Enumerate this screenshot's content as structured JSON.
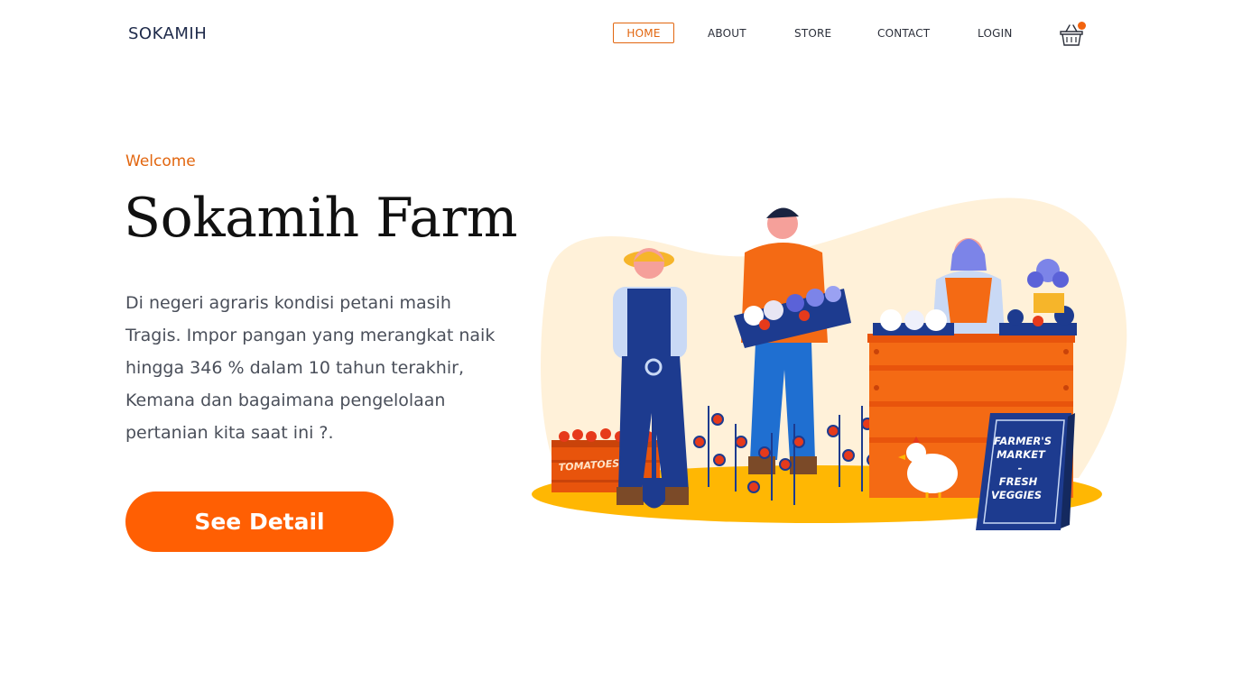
{
  "header": {
    "logo": "SOKAMIH",
    "nav": [
      {
        "label": "HOME",
        "active": true
      },
      {
        "label": "ABOUT"
      },
      {
        "label": "STORE"
      },
      {
        "label": "CONTACT"
      },
      {
        "label": "LOGIN"
      }
    ],
    "cart_icon": "shopping-basket-icon",
    "accent_color": "#f2630e"
  },
  "hero": {
    "eyebrow": "Welcome",
    "title": "Sokamih Farm",
    "description": "Di negeri agraris kondisi petani masih Tragis. Impor pangan yang merangkat naik hingga 346 %  dalam 10 tahun terakhir, Kemana dan bagaimana pengelolaan pertanian kita saat ini ?.",
    "cta_label": "See Detail",
    "cta_color": "#ff5f03"
  },
  "illustration": {
    "crate_label": "TOMATOES",
    "sign_lines": [
      "FARMER'S",
      "MARKET",
      "-",
      "FRESH",
      "VEGGIES"
    ]
  }
}
